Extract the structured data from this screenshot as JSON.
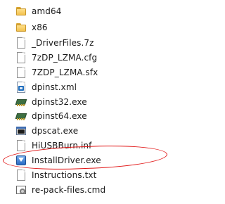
{
  "files": [
    {
      "name": "amd64",
      "icon": "folder-icon"
    },
    {
      "name": "x86",
      "icon": "folder-icon"
    },
    {
      "name": "_DriverFiles.7z",
      "icon": "file-icon"
    },
    {
      "name": "7zDP_LZMA.cfg",
      "icon": "file-icon"
    },
    {
      "name": "7ZDP_LZMA.sfx",
      "icon": "file-icon"
    },
    {
      "name": "dpinst.xml",
      "icon": "xml-file-icon"
    },
    {
      "name": "dpinst32.exe",
      "icon": "chip-exe-icon"
    },
    {
      "name": "dpinst64.exe",
      "icon": "chip-exe-icon"
    },
    {
      "name": "dpscat.exe",
      "icon": "console-exe-icon"
    },
    {
      "name": "HiUSBBurn.inf",
      "icon": "config-file-icon"
    },
    {
      "name": "InstallDriver.exe",
      "icon": "installer-exe-icon"
    },
    {
      "name": "Instructions.txt",
      "icon": "text-file-icon"
    },
    {
      "name": "re-pack-files.cmd",
      "icon": "cmd-file-icon"
    }
  ],
  "highlight": {
    "color": "#e11616",
    "target": "InstallDriver.exe"
  }
}
